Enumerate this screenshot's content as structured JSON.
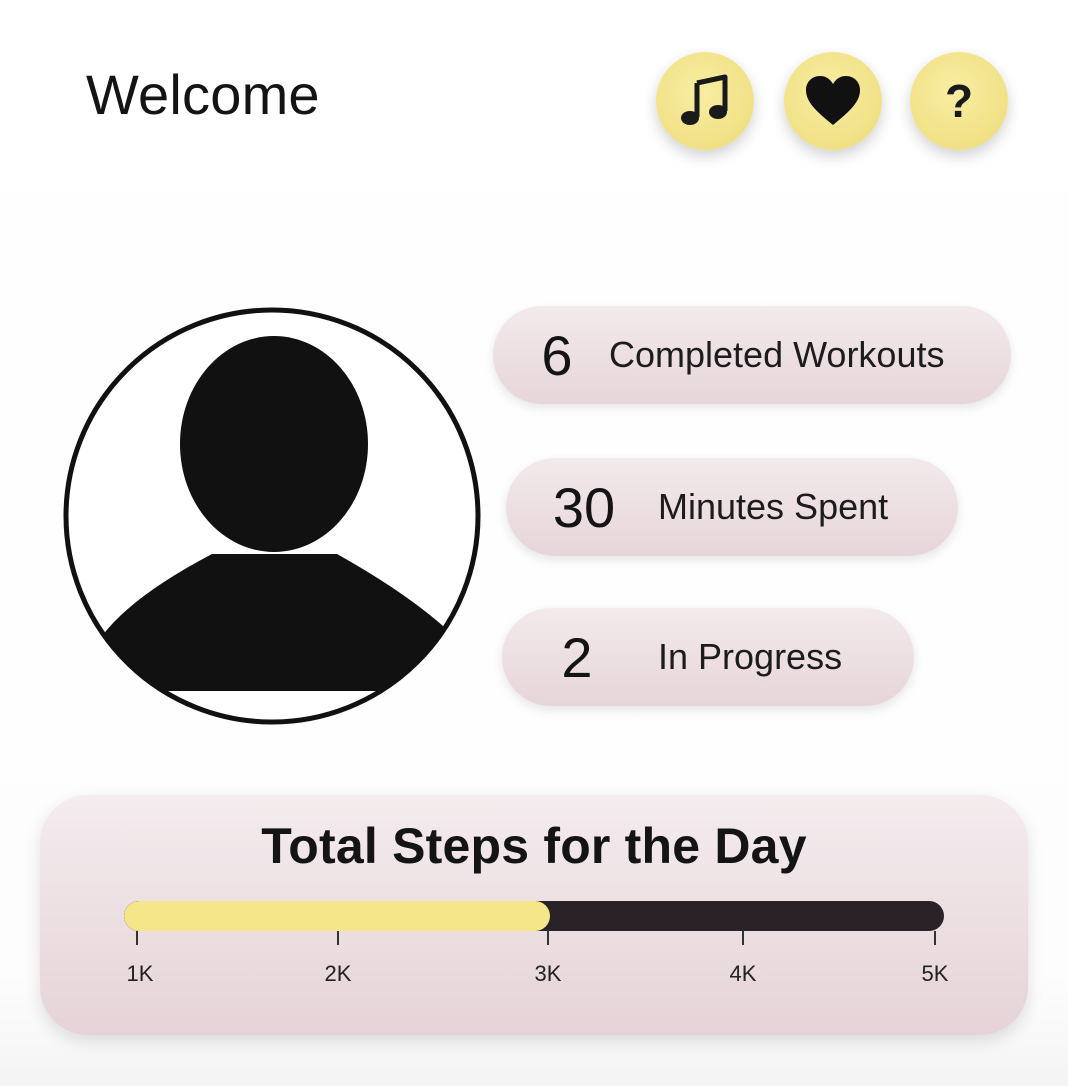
{
  "header": {
    "title": "Welcome",
    "buttons": [
      {
        "name": "music",
        "icon": "music-note-icon"
      },
      {
        "name": "favorites",
        "icon": "heart-icon"
      },
      {
        "name": "help",
        "icon": "question-mark-icon",
        "glyph": "?"
      }
    ]
  },
  "profile": {
    "avatar_icon": "user-silhouette-icon"
  },
  "stats": [
    {
      "value": "6",
      "label": "Completed Workouts"
    },
    {
      "value": "30",
      "label": "Minutes Spent"
    },
    {
      "value": "2",
      "label": "In Progress"
    }
  ],
  "steps": {
    "title": "Total Steps for the Day",
    "progress_fraction": 0.52,
    "ticks": [
      "1K",
      "2K",
      "3K",
      "4K",
      "5K"
    ]
  },
  "colors": {
    "accent_yellow": "#f2e38a",
    "pill_pink": "#e6d5d9",
    "track_dark": "#2a2226"
  }
}
